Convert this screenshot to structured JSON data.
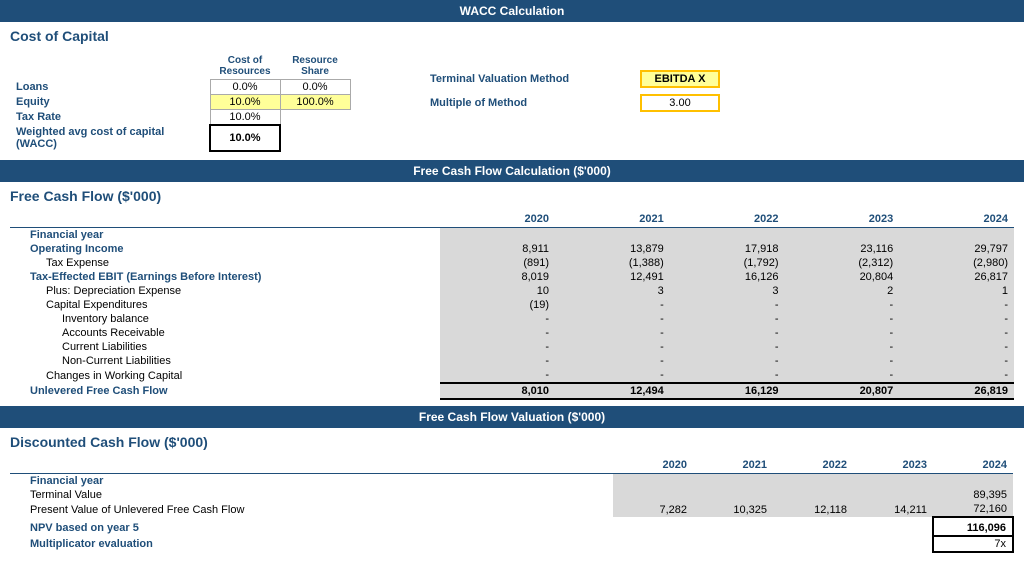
{
  "page": {
    "main_title": "WACC Calculation",
    "fcf_calc_title": "Free Cash Flow Calculation ($'000)",
    "fcf_val_title": "Free Cash Flow Valuation ($'000)",
    "cost_of_capital_title": "Cost of Capital",
    "fcf_section_title": "Free Cash Flow ($'000)",
    "dcf_section_title": "Discounted Cash Flow ($'000)"
  },
  "wacc": {
    "col1_header": "Cost of Resources",
    "col2_header": "Resource Share",
    "rows": [
      {
        "label": "Loans",
        "cost": "0.0%",
        "share": "0.0%",
        "cost_style": "value",
        "share_style": "value"
      },
      {
        "label": "Equity",
        "cost": "10.0%",
        "share": "100.0%",
        "cost_style": "yellow",
        "share_style": "yellow"
      },
      {
        "label": "Tax Rate",
        "cost": "10.0%",
        "share": "",
        "cost_style": "value",
        "share_style": "empty"
      },
      {
        "label": "Weighted avg cost of capital (WACC)",
        "cost": "10.0%",
        "share": "",
        "cost_style": "bold-border",
        "share_style": "empty"
      }
    ],
    "terminal_label": "Terminal Valuation Method",
    "terminal_value": "EBITDA X",
    "multiple_label": "Multiple of Method",
    "multiple_value": "3.00"
  },
  "fcf": {
    "years": [
      "2020",
      "2021",
      "2022",
      "2023",
      "2024"
    ],
    "rows": [
      {
        "label": "Financial year",
        "values": [
          "",
          "",
          "",
          "",
          ""
        ],
        "style": "header",
        "indent": 0
      },
      {
        "label": "Operating Income",
        "values": [
          "8,911",
          "13,879",
          "17,918",
          "23,116",
          "29,797"
        ],
        "style": "bold",
        "indent": 1
      },
      {
        "label": "Tax Expense",
        "values": [
          "(891)",
          "(1,388)",
          "(1,792)",
          "(2,312)",
          "(2,980)"
        ],
        "style": "normal",
        "indent": 2
      },
      {
        "label": "Tax-Effected EBIT (Earnings Before Interest)",
        "values": [
          "8,019",
          "12,491",
          "16,126",
          "20,804",
          "26,817"
        ],
        "style": "bold",
        "indent": 1
      },
      {
        "label": "Plus: Depreciation Expense",
        "values": [
          "10",
          "3",
          "3",
          "2",
          "1"
        ],
        "style": "normal",
        "indent": 2
      },
      {
        "label": "Capital Expenditures",
        "values": [
          "(19)",
          "-",
          "-",
          "-",
          "-"
        ],
        "style": "normal",
        "indent": 2
      },
      {
        "label": "Inventory balance",
        "values": [
          "-",
          "-",
          "-",
          "-",
          "-"
        ],
        "style": "normal",
        "indent": 3
      },
      {
        "label": "Accounts Receivable",
        "values": [
          "-",
          "-",
          "-",
          "-",
          "-"
        ],
        "style": "normal",
        "indent": 3
      },
      {
        "label": "Current Liabilities",
        "values": [
          "-",
          "-",
          "-",
          "-",
          "-"
        ],
        "style": "normal",
        "indent": 3
      },
      {
        "label": "Non-Current Liabilities",
        "values": [
          "-",
          "-",
          "-",
          "-",
          "-"
        ],
        "style": "normal",
        "indent": 3
      },
      {
        "label": "Changes in Working Capital",
        "values": [
          "-",
          "-",
          "-",
          "-",
          "-"
        ],
        "style": "normal",
        "indent": 2
      },
      {
        "label": "Unlevered Free Cash Flow",
        "values": [
          "8,010",
          "12,494",
          "16,129",
          "20,807",
          "26,819"
        ],
        "style": "bold-border",
        "indent": 1
      }
    ]
  },
  "dcf": {
    "years": [
      "2020",
      "2021",
      "2022",
      "2023",
      "2024"
    ],
    "rows": [
      {
        "label": "Financial year",
        "values": [
          "",
          "",
          "",
          "",
          ""
        ],
        "style": "header",
        "indent": 0
      },
      {
        "label": "Terminal Value",
        "values": [
          "",
          "",
          "",
          "",
          "89,395"
        ],
        "style": "normal",
        "indent": 1
      },
      {
        "label": "Present Value of Unlevered Free Cash Flow",
        "values": [
          "7,282",
          "10,325",
          "12,118",
          "14,211",
          "72,160"
        ],
        "style": "normal",
        "indent": 1
      }
    ],
    "npv_label": "NPV based on year 5",
    "npv_value": "116,096",
    "mult_label": "Multiplicator evaluation",
    "mult_value": "7x"
  }
}
